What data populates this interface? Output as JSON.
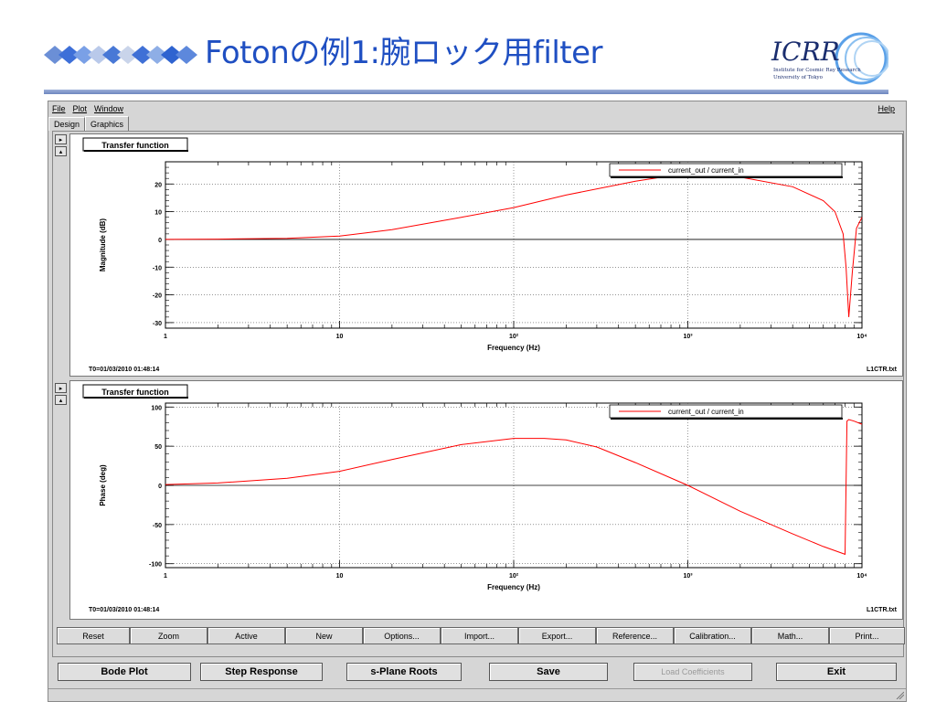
{
  "slide": {
    "title": "Fotonの例1:腕ロック用filter",
    "logo_text": "ICRR",
    "logo_sub1": "Institute for Cosmic Ray Research",
    "logo_sub2": "University of Tokyo"
  },
  "window": {
    "menu": [
      "File",
      "Plot",
      "Window"
    ],
    "help": "Help",
    "tabs": [
      "Design",
      "Graphics"
    ],
    "active_tab": "Graphics"
  },
  "panels": {
    "magnitude": {
      "label": "Transfer function",
      "ylabel": "Magnitude (dB)",
      "xlabel": "Frequency (Hz)",
      "legend": "current_out / current_in",
      "timestamp": "T0=01/03/2010 01:48:14",
      "file": "L1CTR.txt"
    },
    "phase": {
      "label": "Transfer function",
      "ylabel": "Phase (deg)",
      "xlabel": "Frequency (Hz)",
      "legend": "current_out / current_in",
      "timestamp": "T0=01/03/2010 01:48:14",
      "file": "L1CTR.txt"
    }
  },
  "toolbar": [
    "Reset",
    "Zoom",
    "Active",
    "New",
    "Options...",
    "Import...",
    "Export...",
    "Reference...",
    "Calibration...",
    "Math...",
    "Print..."
  ],
  "actions": {
    "bode": "Bode Plot",
    "step": "Step Response",
    "splane": "s-Plane Roots",
    "save": "Save",
    "load": "Load Coefficients",
    "exit": "Exit"
  },
  "colors": {
    "trace": "#ff0000",
    "title": "#1f4fc2"
  },
  "chart_data": [
    {
      "type": "line",
      "xscale": "log",
      "xlim": [
        1,
        10000
      ],
      "ylim": [
        -32,
        28
      ],
      "xticks": [
        "1",
        "10",
        "10²",
        "10³",
        "10⁴"
      ],
      "yticks": [
        20,
        10,
        0,
        -10,
        -20,
        -30
      ],
      "xlabel": "Frequency (Hz)",
      "ylabel": "Magnitude (dB)",
      "series": [
        {
          "name": "current_out / current_in",
          "x": [
            1,
            2,
            5,
            10,
            20,
            50,
            100,
            200,
            500,
            800,
            1000,
            2000,
            4000,
            6000,
            7000,
            7800,
            8100,
            8400,
            8800,
            9300,
            10000
          ],
          "y": [
            0,
            0.1,
            0.4,
            1.2,
            3.5,
            8,
            11.5,
            16,
            21,
            23,
            23.5,
            22.5,
            19,
            14,
            10,
            2,
            -10,
            -28,
            -12,
            4,
            8
          ]
        }
      ]
    },
    {
      "type": "line",
      "xscale": "log",
      "xlim": [
        1,
        10000
      ],
      "ylim": [
        -105,
        105
      ],
      "xticks": [
        "1",
        "10",
        "10²",
        "10³",
        "10⁴"
      ],
      "yticks": [
        100,
        50,
        0,
        -50,
        -100
      ],
      "xlabel": "Frequency (Hz)",
      "ylabel": "Phase (deg)",
      "series": [
        {
          "name": "current_out / current_in",
          "x": [
            1,
            2,
            5,
            10,
            20,
            50,
            100,
            150,
            200,
            300,
            500,
            1000,
            2000,
            4000,
            6000,
            8000,
            8200,
            8400,
            9000,
            10000
          ],
          "y": [
            1,
            3,
            9,
            18,
            33,
            52,
            60,
            60,
            58,
            49,
            29,
            0,
            -33,
            -62,
            -78,
            -88,
            82,
            84,
            82,
            78
          ]
        }
      ]
    }
  ]
}
